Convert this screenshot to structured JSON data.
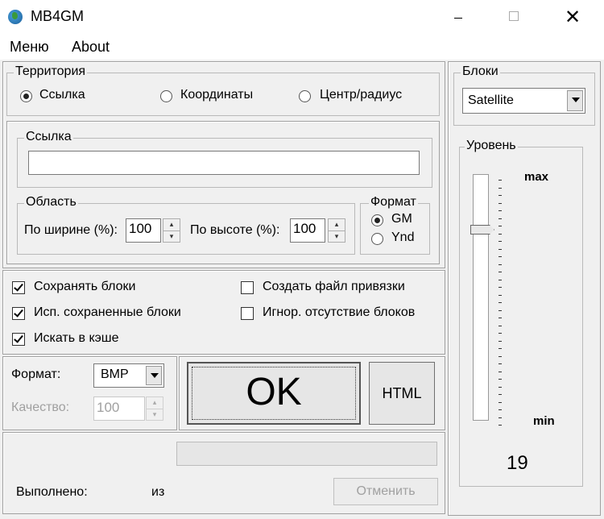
{
  "window": {
    "title": "MB4GM"
  },
  "menu": {
    "items": [
      "Меню",
      "About"
    ]
  },
  "territory": {
    "title": "Территория",
    "options": [
      "Ссылка",
      "Координаты",
      "Центр/радиус"
    ],
    "selected": "Ссылка"
  },
  "link": {
    "title": "Ссылка",
    "value": ""
  },
  "area": {
    "title": "Область",
    "width_label": "По ширине (%):",
    "width_value": "100",
    "height_label": "По высоте (%):",
    "height_value": "100"
  },
  "format_group": {
    "title": "Формат",
    "options": [
      "GM",
      "Ynd"
    ],
    "selected": "GM"
  },
  "checkboxes": [
    {
      "label": "Сохранять блоки",
      "checked": true
    },
    {
      "label": "Исп. сохраненные блоки",
      "checked": true
    },
    {
      "label": "Искать в кэше",
      "checked": true
    },
    {
      "label": "Создать файл привязки",
      "checked": false
    },
    {
      "label": "Игнор. отсутствие блоков",
      "checked": false
    }
  ],
  "output": {
    "format_label": "Формат:",
    "format_value": "BMP",
    "quality_label": "Качество:",
    "quality_value": "100"
  },
  "buttons": {
    "ok": "OK",
    "html": "HTML",
    "cancel": "Отменить"
  },
  "status": {
    "done_label": "Выполнено:",
    "of_label": "из"
  },
  "blocks": {
    "title": "Блоки",
    "value": "Satellite"
  },
  "level": {
    "title": "Уровень",
    "max_label": "max",
    "min_label": "min",
    "value": "19"
  }
}
